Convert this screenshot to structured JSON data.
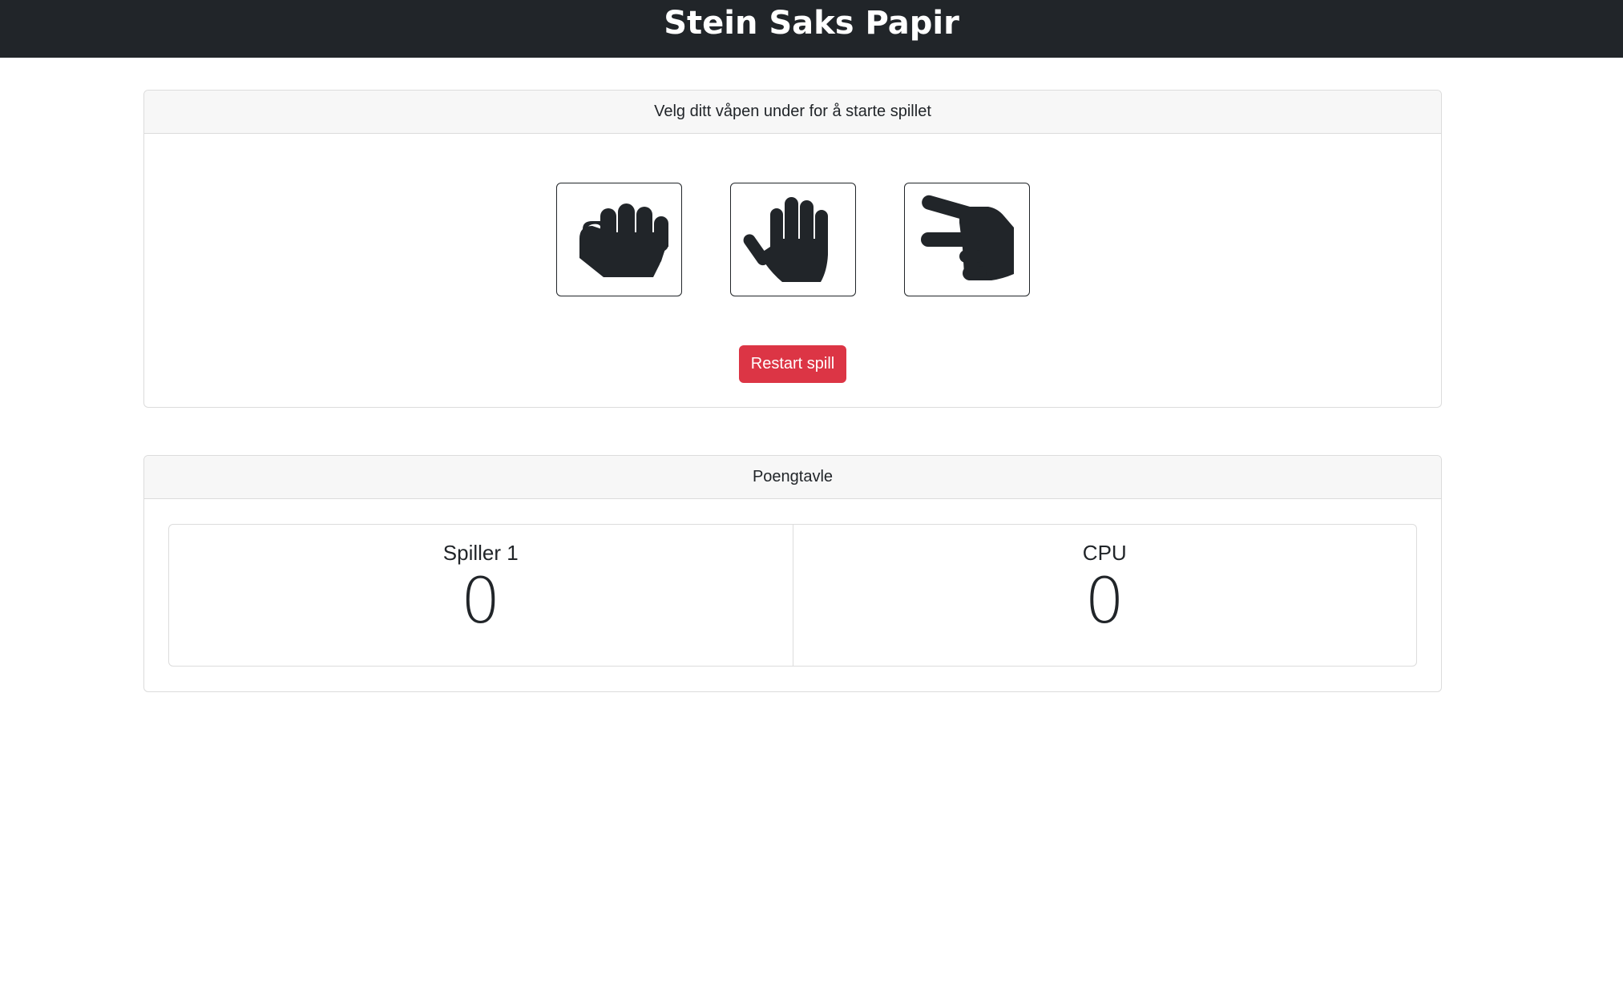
{
  "header": {
    "title": "Stein Saks Papir"
  },
  "game": {
    "prompt": "Velg ditt våpen under for å starte spillet",
    "weapons": [
      {
        "icon": "hand-rock-icon"
      },
      {
        "icon": "hand-paper-icon"
      },
      {
        "icon": "hand-scissors-icon"
      }
    ],
    "restart_label": "Restart spill",
    "restart_color": "#dc3545"
  },
  "scoreboard": {
    "title": "Poengtavle",
    "players": [
      {
        "name": "Spiller 1",
        "score": "0"
      },
      {
        "name": "CPU",
        "score": "0"
      }
    ]
  },
  "colors": {
    "navbar": "#212529",
    "icon": "#212529"
  }
}
